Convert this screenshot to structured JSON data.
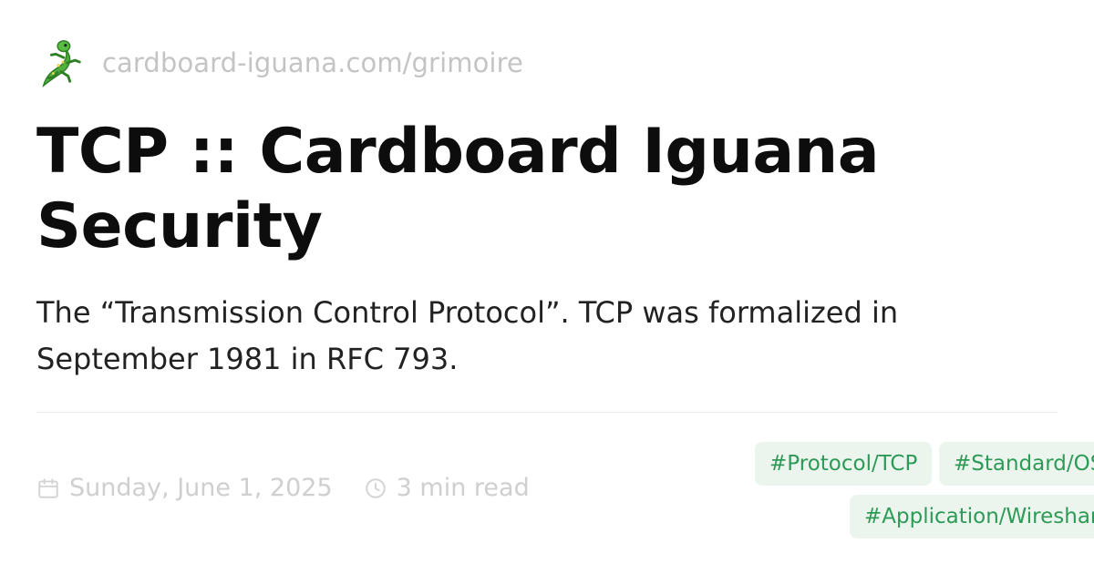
{
  "site": {
    "url": "cardboard-iguana.com/grimoire",
    "logo_icon": "lizard-icon"
  },
  "post": {
    "title": "TCP :: Cardboard Iguana Security",
    "summary": "The “Transmission Control Protocol”. TCP was formalized in September 1981 in RFC 793."
  },
  "meta": {
    "date": "Sunday, June 1, 2025",
    "date_icon": "calendar-icon",
    "read_time": "3 min read",
    "read_time_icon": "clock-icon"
  },
  "tags": [
    "#Protocol/TCP",
    "#Standard/OSI",
    "#Application/Wireshark"
  ],
  "colors": {
    "tag_background": "#ebf5ee",
    "tag_text": "#2e9a57",
    "muted_text": "#c4c4c4"
  }
}
